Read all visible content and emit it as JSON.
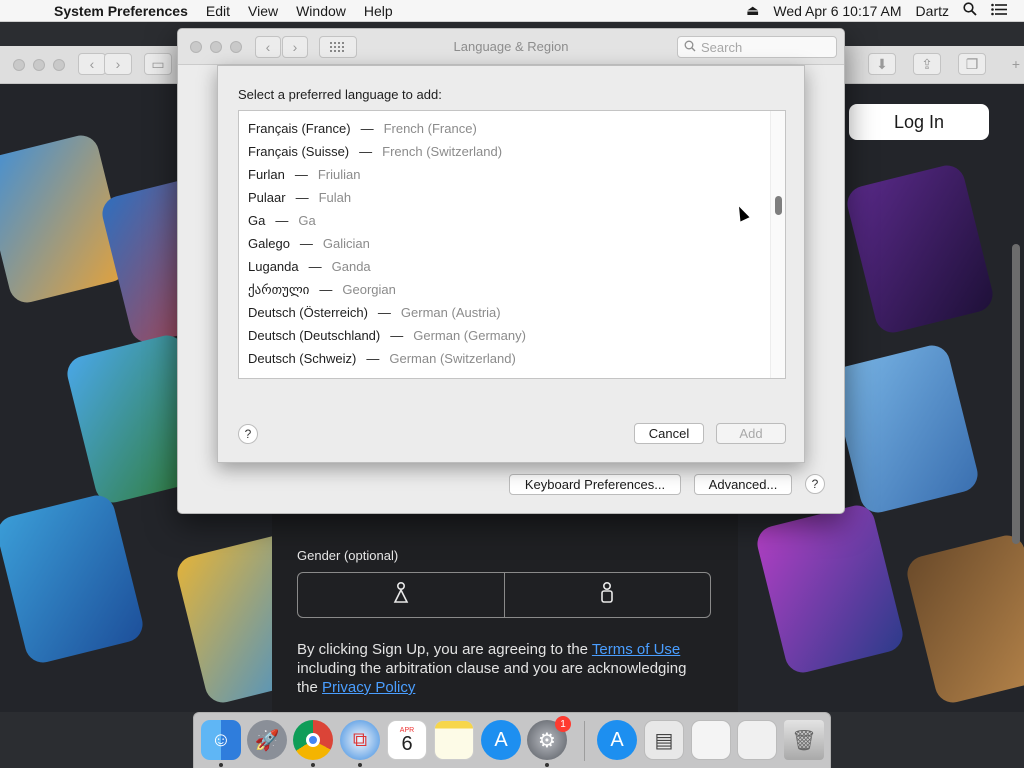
{
  "menubar": {
    "apple": "",
    "app": "System Preferences",
    "items": [
      "Edit",
      "View",
      "Window",
      "Help"
    ],
    "datetime": "Wed Apr 6  10:17 AM",
    "user": "Dartz"
  },
  "website": {
    "login_label": "Log In",
    "gender_label": "Gender (optional)",
    "terms_prefix": "By clicking Sign Up, you are agreeing to the ",
    "terms_link": "Terms of Use",
    "terms_middle": " including the arbitration clause and you are acknowledging the ",
    "privacy_link": "Privacy Policy"
  },
  "prefs_window": {
    "title": "Language & Region",
    "search_placeholder": "Search",
    "keyboard_button": "Keyboard Preferences...",
    "advanced_button": "Advanced...",
    "help": "?"
  },
  "sheet": {
    "prompt": "Select a preferred language to add:",
    "languages": [
      {
        "native": "Français (France)",
        "english": "French (France)"
      },
      {
        "native": "Français (Suisse)",
        "english": "French (Switzerland)"
      },
      {
        "native": "Furlan",
        "english": "Friulian"
      },
      {
        "native": "Pulaar",
        "english": "Fulah"
      },
      {
        "native": "Ga",
        "english": "Ga"
      },
      {
        "native": "Galego",
        "english": "Galician"
      },
      {
        "native": "Luganda",
        "english": "Ganda"
      },
      {
        "native": "ქართული",
        "english": "Georgian"
      },
      {
        "native": "Deutsch (Österreich)",
        "english": "German (Austria)"
      },
      {
        "native": "Deutsch (Deutschland)",
        "english": "German (Germany)"
      },
      {
        "native": "Deutsch (Schweiz)",
        "english": "German (Switzerland)"
      }
    ],
    "dash": "—",
    "help": "?",
    "cancel_label": "Cancel",
    "add_label": "Add"
  },
  "dock": {
    "calendar_month": "APR",
    "calendar_day": "6",
    "prefs_badge": "1",
    "icons": [
      "finder-icon",
      "launchpad-icon",
      "chrome-icon",
      "safari-icon",
      "calendar-icon",
      "notes-icon",
      "app-store-icon",
      "system-preferences-icon",
      "app-store-icon",
      "document-icon",
      "window-icon",
      "window-icon",
      "trash-icon"
    ]
  }
}
